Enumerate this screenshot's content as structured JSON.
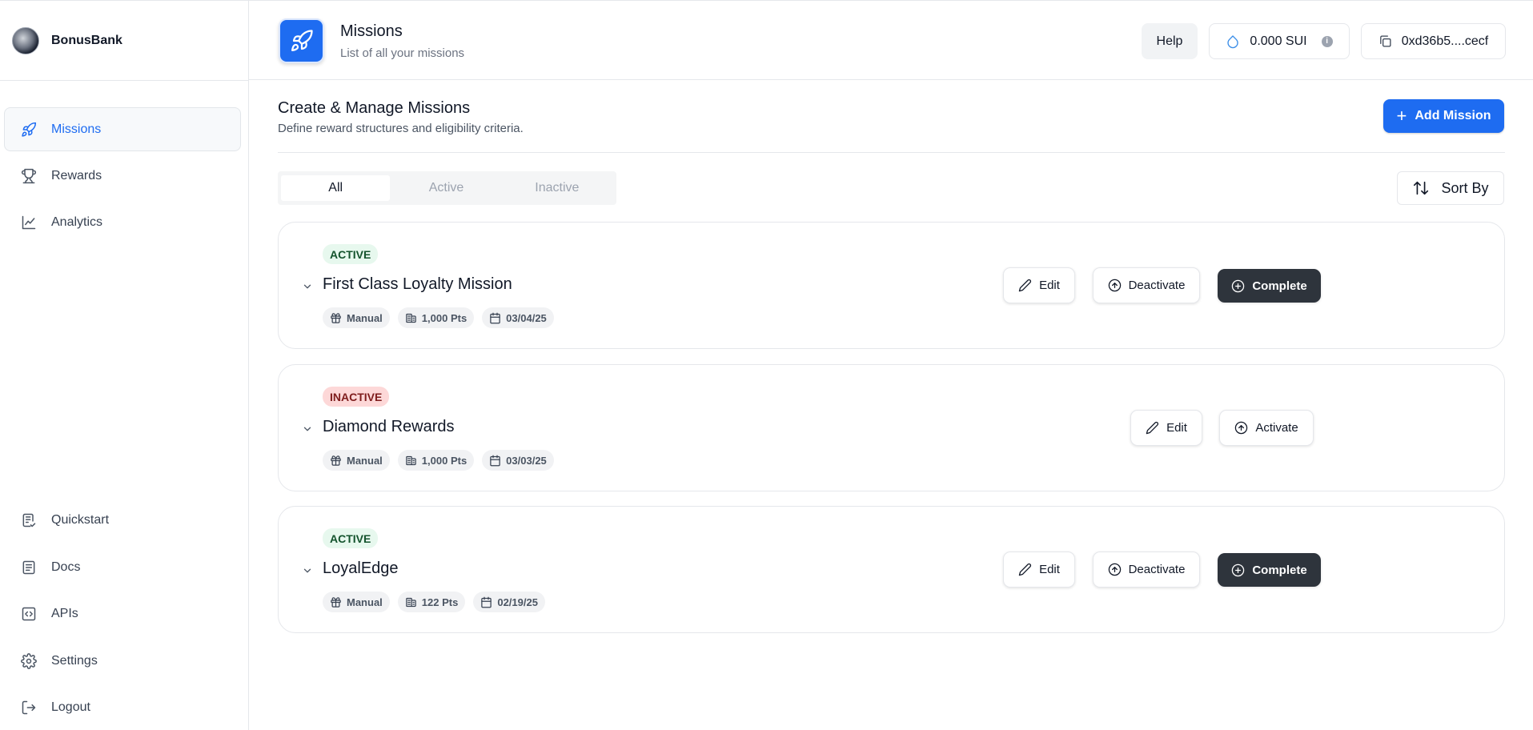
{
  "brand": {
    "name": "BonusBank"
  },
  "sidebar": {
    "top_items": [
      {
        "label": "Missions",
        "icon": "rocket-icon",
        "active": true
      },
      {
        "label": "Rewards",
        "icon": "trophy-icon"
      },
      {
        "label": "Analytics",
        "icon": "line-chart-icon"
      }
    ],
    "bottom_items": [
      {
        "label": "Quickstart",
        "icon": "checklist-icon"
      },
      {
        "label": "Docs",
        "icon": "document-icon"
      },
      {
        "label": "APIs",
        "icon": "code-icon"
      },
      {
        "label": "Settings",
        "icon": "gear-icon"
      },
      {
        "label": "Logout",
        "icon": "logout-icon"
      }
    ]
  },
  "header": {
    "title": "Missions",
    "subtitle": "List of all your missions",
    "help_label": "Help",
    "balance": "0.000 SUI",
    "address": "0xd36b5....cecf"
  },
  "main": {
    "title": "Create & Manage Missions",
    "subtitle": "Define reward structures and eligibility criteria.",
    "add_label": "Add Mission",
    "tabs": [
      "All",
      "Active",
      "Inactive"
    ],
    "sort_label": "Sort By"
  },
  "missions": [
    {
      "status": "ACTIVE",
      "title": "First Class Loyalty Mission",
      "type": "Manual",
      "points": "1,000 Pts",
      "date": "03/04/25",
      "actions": [
        "Edit",
        "Deactivate",
        "Complete"
      ]
    },
    {
      "status": "INACTIVE",
      "title": "Diamond Rewards",
      "type": "Manual",
      "points": "1,000 Pts",
      "date": "03/03/25",
      "actions": [
        "Edit",
        "Activate"
      ]
    },
    {
      "status": "ACTIVE",
      "title": "LoyalEdge",
      "type": "Manual",
      "points": "122 Pts",
      "date": "02/19/25",
      "actions": [
        "Edit",
        "Deactivate",
        "Complete"
      ]
    }
  ],
  "colors": {
    "accent": "#1e6cf1",
    "active_badge_bg": "#e7f8ee",
    "inactive_badge_bg": "#fdd8d8",
    "dark_button": "#2e343c"
  }
}
